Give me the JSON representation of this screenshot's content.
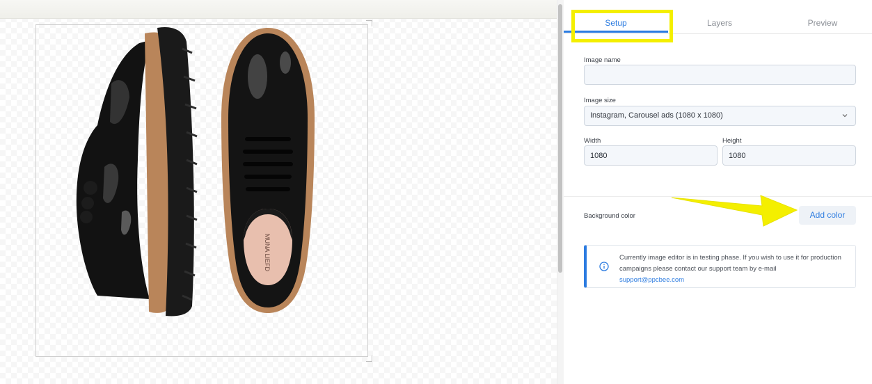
{
  "tabs": {
    "setup": "Setup",
    "layers": "Layers",
    "preview": "Preview"
  },
  "setup": {
    "image_name": {
      "label": "Image name",
      "value": ""
    },
    "image_size": {
      "label": "Image size",
      "value": "Instagram, Carousel ads (1080 x 1080)"
    },
    "width": {
      "label": "Width",
      "value": "1080"
    },
    "height": {
      "label": "Height",
      "value": "1080"
    },
    "background_color": {
      "label": "Background color",
      "button": "Add color"
    }
  },
  "notice": {
    "text": "Currently image editor is in testing phase. If you wish to use it for production campaigns please contact our support team by e-mail",
    "email": "support@ppcbee.com"
  },
  "colors": {
    "accent": "#2b7be0",
    "highlight": "#f4ef00"
  },
  "icons": [
    "chevron-down-icon",
    "info-icon",
    "annotation-arrow"
  ]
}
